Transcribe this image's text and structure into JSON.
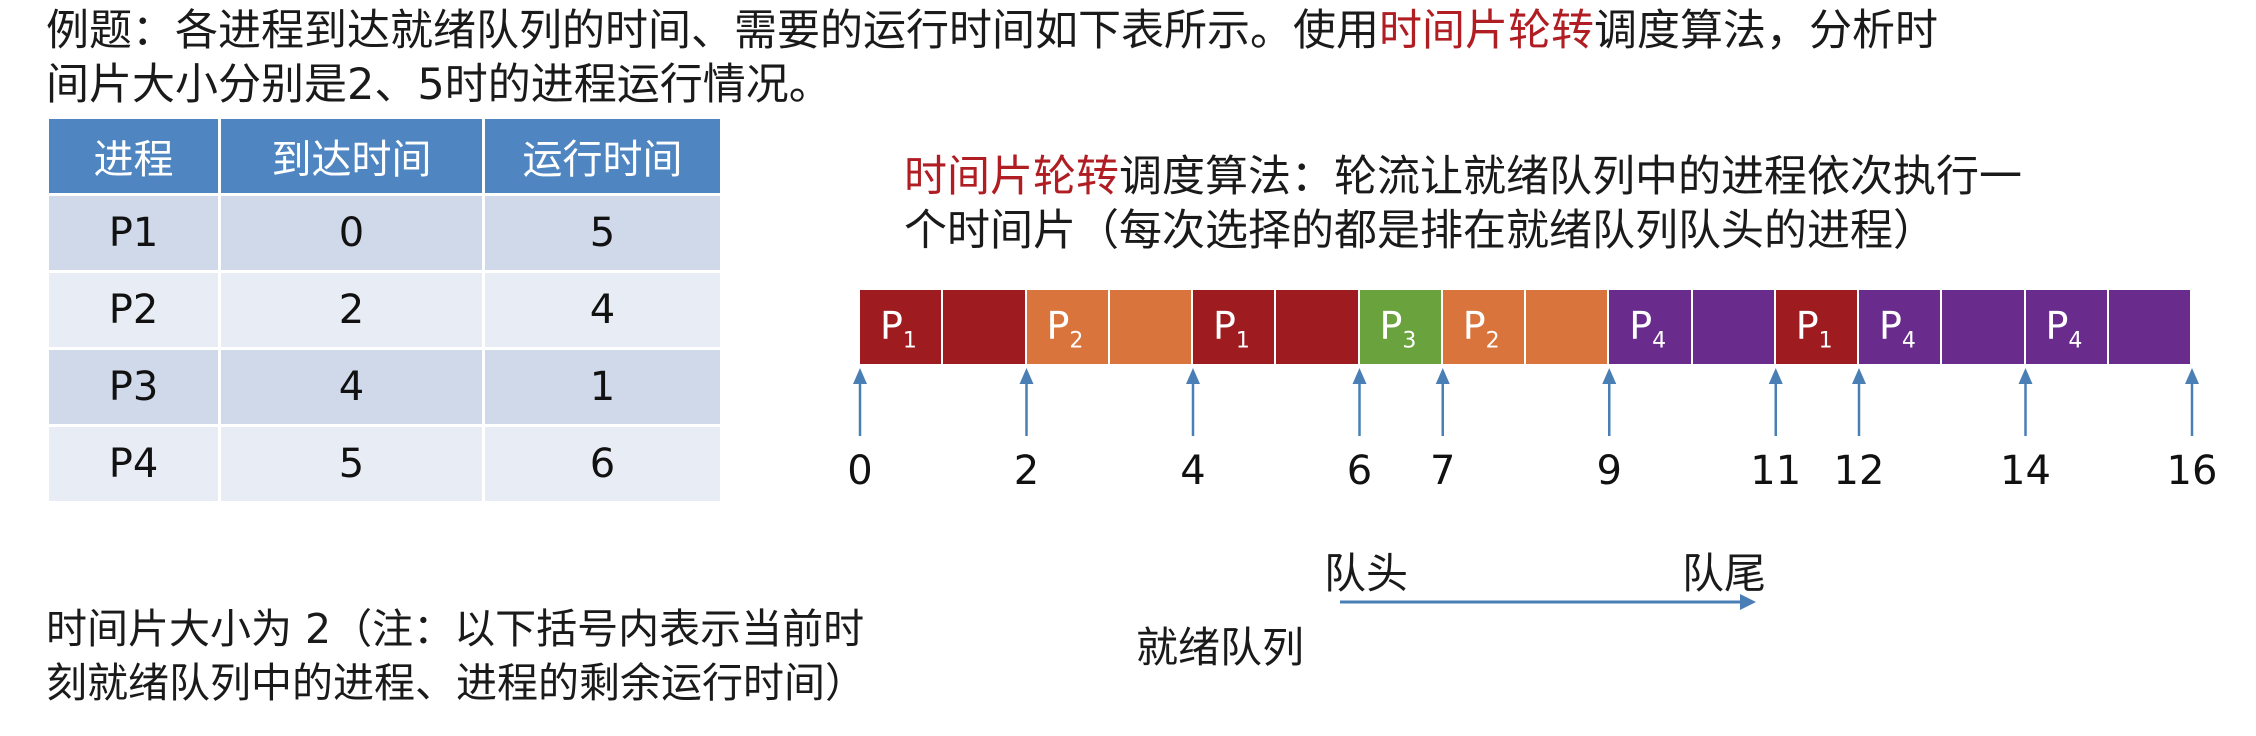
{
  "question": {
    "line1_a": "例题：各进程到达就绪队列的时间、需要的运行时间如下表所示。使用",
    "line1_hl": "时间片轮转",
    "line1_b": "调度算法，分析时",
    "line2": "间片大小分别是2、5时的进程运行情况。"
  },
  "table": {
    "headers": [
      "进程",
      "到达时间",
      "运行时间"
    ],
    "rows": [
      [
        "P1",
        "0",
        "5"
      ],
      [
        "P2",
        "2",
        "4"
      ],
      [
        "P3",
        "4",
        "1"
      ],
      [
        "P4",
        "5",
        "6"
      ]
    ]
  },
  "definition": {
    "hl": "时间片轮转",
    "line1_b": "调度算法：轮流让就绪队列中的进程依次执行一",
    "line2": "个时间片（每次选择的都是排在就绪队列队头的进程）"
  },
  "gantt": {
    "time_start": 0,
    "time_end": 16,
    "segments": [
      {
        "proc": "P",
        "sub": "1",
        "start": 0,
        "end": 2,
        "color": "#9e1b20",
        "show_label": true
      },
      {
        "proc": "P",
        "sub": "1",
        "start": 1,
        "end": 2,
        "color": "#9e1b20",
        "show_label": false
      },
      {
        "proc": "P",
        "sub": "2",
        "start": 2,
        "end": 3,
        "color": "#d9753c",
        "show_label": true
      },
      {
        "proc": "P",
        "sub": "2",
        "start": 3,
        "end": 4,
        "color": "#d9753c",
        "show_label": false
      },
      {
        "proc": "P",
        "sub": "1",
        "start": 4,
        "end": 5,
        "color": "#9e1b20",
        "show_label": true
      },
      {
        "proc": "P",
        "sub": "1",
        "start": 5,
        "end": 6,
        "color": "#9e1b20",
        "show_label": false
      },
      {
        "proc": "P",
        "sub": "3",
        "start": 6,
        "end": 7,
        "color": "#6aa23e",
        "show_label": true
      },
      {
        "proc": "P",
        "sub": "2",
        "start": 7,
        "end": 8,
        "color": "#d9753c",
        "show_label": true
      },
      {
        "proc": "P",
        "sub": "2",
        "start": 8,
        "end": 9,
        "color": "#d9753c",
        "show_label": false
      },
      {
        "proc": "P",
        "sub": "4",
        "start": 9,
        "end": 10,
        "color": "#6a2c8c",
        "show_label": true
      },
      {
        "proc": "P",
        "sub": "4",
        "start": 10,
        "end": 11,
        "color": "#6a2c8c",
        "show_label": false
      },
      {
        "proc": "P",
        "sub": "1",
        "start": 11,
        "end": 12,
        "color": "#9e1b20",
        "show_label": true
      },
      {
        "proc": "P",
        "sub": "4",
        "start": 12,
        "end": 13,
        "color": "#6a2c8c",
        "show_label": true
      },
      {
        "proc": "P",
        "sub": "4",
        "start": 13,
        "end": 14,
        "color": "#6a2c8c",
        "show_label": false
      },
      {
        "proc": "P",
        "sub": "4",
        "start": 14,
        "end": 15,
        "color": "#6a2c8c",
        "show_label": true
      },
      {
        "proc": "P",
        "sub": "4",
        "start": 15,
        "end": 16,
        "color": "#6a2c8c",
        "show_label": false
      }
    ],
    "ticks": [
      "0",
      "2",
      "4",
      "6",
      "7",
      "9",
      "11",
      "12",
      "14",
      "16"
    ],
    "arrow_color": "#4a7fb5"
  },
  "bottom": {
    "line1": "时间片大小为 2（注：以下括号内表示当前时",
    "line2": "刻就绪队列中的进程、进程的剩余运行时间）"
  },
  "queue": {
    "head": "队头",
    "tail": "队尾",
    "label": "就绪队列"
  }
}
